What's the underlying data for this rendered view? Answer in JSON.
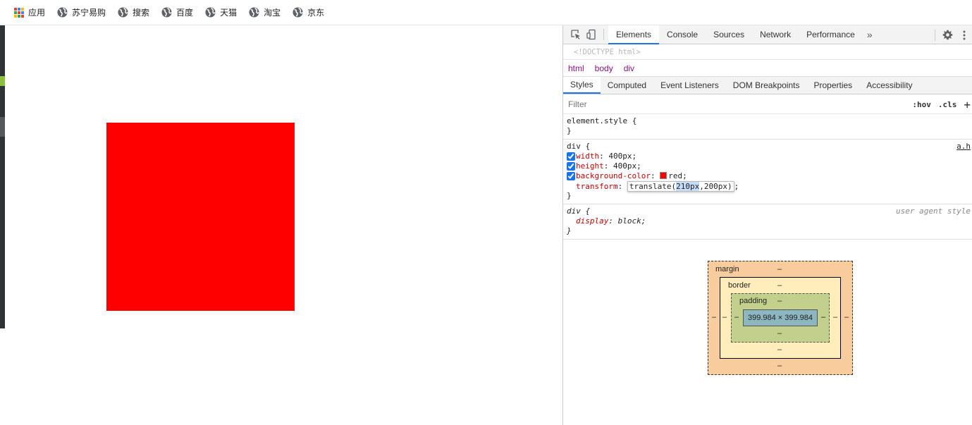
{
  "bookmarks": {
    "apps_label": "应用",
    "items": [
      "苏宁易购",
      "搜索",
      "百度",
      "天猫",
      "淘宝",
      "京东"
    ]
  },
  "colors": {
    "box_color": "#ff0000",
    "accent": "#1a73e8"
  },
  "devtools": {
    "tabs": [
      "Elements",
      "Console",
      "Sources",
      "Network",
      "Performance"
    ],
    "more_label": "»",
    "doctype": "<!DOCTYPE html>",
    "breadcrumbs": [
      "html",
      "body",
      "div"
    ],
    "subtabs": [
      "Styles",
      "Computed",
      "Event Listeners",
      "DOM Breakpoints",
      "Properties",
      "Accessibility"
    ],
    "filter": {
      "placeholder": "Filter",
      "hov": ":hov",
      "cls": ".cls",
      "plus": "+"
    },
    "rules": {
      "element_style": {
        "selector": "element.style {",
        "close": "}"
      },
      "div_rule": {
        "selector": "div {",
        "source": "a.h",
        "width_prop": "width",
        "width_val": "400px;",
        "height_prop": "height",
        "height_val": "400px;",
        "bg_prop": "background-color",
        "bg_val": "red;",
        "transform_prop": "transform",
        "transform_pre": "translate(",
        "transform_hl": "210px",
        "transform_post": ",200px)",
        "transform_end": ";",
        "close": "}"
      },
      "ua_rule": {
        "selector": "div {",
        "source": "user agent style",
        "display_prop": "display",
        "display_val": "block;",
        "close": "}"
      }
    },
    "box_model": {
      "margin_label": "margin",
      "border_label": "border",
      "padding_label": "padding",
      "dash": "–",
      "content_size": "399.984 × 399.984"
    }
  }
}
